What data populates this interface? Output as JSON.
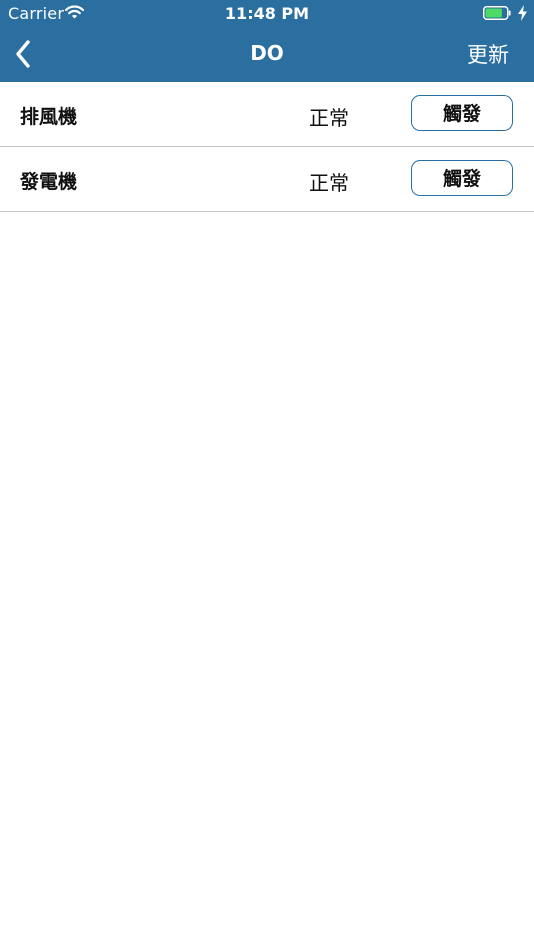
{
  "status_bar": {
    "carrier": "Carrier",
    "time": "11:48 PM",
    "wifi_icon": "wifi-icon",
    "battery_icon": "battery-charging-icon",
    "battery_level": 0.8
  },
  "nav": {
    "back_icon": "chevron-left-icon",
    "title": "DO",
    "refresh_label": "更新"
  },
  "rows": [
    {
      "name": "排風機",
      "status": "正常",
      "action_label": "觸發"
    },
    {
      "name": "發電機",
      "status": "正常",
      "action_label": "觸發"
    }
  ],
  "colors": {
    "nav_background": "#2a6fa0",
    "battery_fill": "#4cd964",
    "separator": "#c8c8cc",
    "button_border": "#2a6fa0"
  }
}
